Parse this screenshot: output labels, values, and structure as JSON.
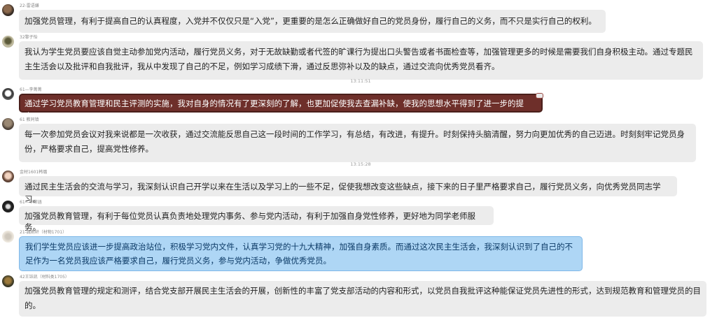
{
  "messages": [
    {
      "sender": "22-雷语嫌",
      "text": "加强党员管理，有利于提高自己的认真程度，入党并不仅仅只是“入党”，更重要的是怎么正确做好自己的党员身份，履行自己的义务，而不只是实行自己的权利。"
    },
    {
      "sender": "32黎子怡",
      "text": "我认为学生党员要应该自觉主动参加党内活动，履行党员义务，对于无故缺勤或者代签的旷课行为提出口头警告或者书面检查等，加强管理更多的时候是需要我们自身积极主动。通过专题民主生活会以及批评和自我批评，我从中发现了自己的不足，例如学习成绩下滑，通过反思弥补以及的缺点，通过交流向优秀党员看齐。"
    },
    {
      "sender": "61—李菁菁",
      "text": "通过学习党员教育管理和民主评测的实施，我对自身的情况有了更深刻的了解，也更加促使我去查漏补缺，使我的思想水平得到了进一步的提高。"
    },
    {
      "sender": "61 教同镇",
      "text": "每一次参加党员会议对我来说都是一次收获，通过交流能反思自己这一段时间的工作学习，有总结，有改进，有提升。时刻保持头脑清醒，努力向更加优秀的自己迈进。时刻刻牢记党员身份，严格要求自己，提高党性修养。"
    },
    {
      "sender": "金材1601韩璐",
      "text": "通过民主生活会的交流与学习，我深刻认识自己开学以来在生活以及学习上的一些不足，促使我想改变这些缺点，接下来的日子里严格要求自己，履行党员义务，向优秀党员同志学习。"
    },
    {
      "sender": "61—毕柳涵",
      "text": "加强党员教育管理，有利于每位党员认真负责地处理党内事务、参与党内活动，有利于加强自身党性修养，更好地为同学老师服务。"
    },
    {
      "sender": "21-魏雨轩（材物1701）",
      "text": "我们学生党员应该进一步提高政治站位，积极学习党内文件，认真学习党的十九大精神，加强自身素质。而通过这次民主生活会，我深刻认识到了自己的不足作为一名党员我应该严格要求自己，履行党员义务，参与党内活动，争做优秀党员。"
    },
    {
      "sender": "42王钰凯（材料类1705）",
      "text": "加强党员教育管理的规定和测评，结合党支部开展民主生活会的开展，创新性的丰富了党支部活动的内容和形式，以党员自我批评这种能保证党员先进性的形式，达到规范教育和管理党员的目的。"
    }
  ],
  "timestamps": [
    "13:11:51",
    "13:15:28"
  ],
  "colors": {
    "bubble_default": "#ececec",
    "bubble_highlight_red": "#6e2f2a",
    "bubble_highlight_blue": "#aed6f5"
  }
}
